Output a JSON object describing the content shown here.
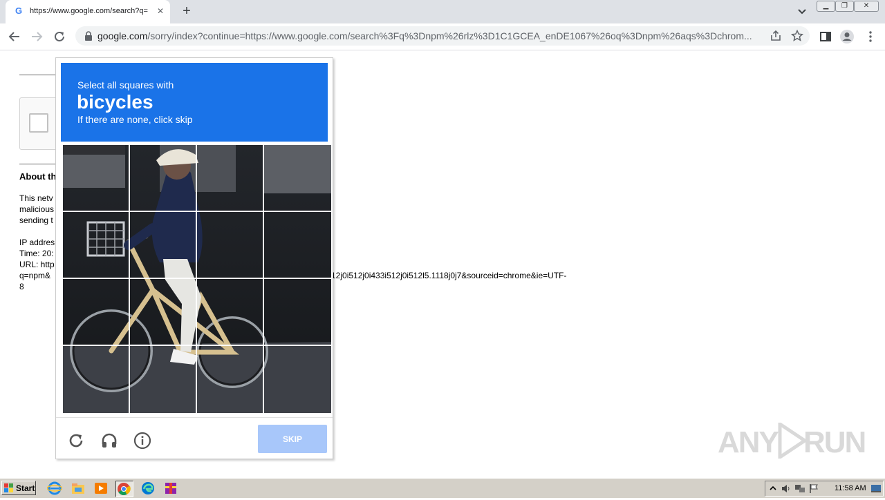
{
  "browser": {
    "tab_title": "https://www.google.com/search?q=",
    "tab_favicon": "G",
    "url_host": "google.com",
    "url_rest": "/sorry/index?continue=https://www.google.com/search%3Fq%3Dnpm%26rlz%3D1C1GCEA_enDE1067%26oq%3Dnpm%26aqs%3Dchrom..."
  },
  "page": {
    "about_heading": "About th",
    "para1": [
      "This netv",
      "malicious",
      "sending t"
    ],
    "para2": [
      "IP addres",
      "Time: 20:",
      "URL: http",
      "q=npm&",
      "8"
    ],
    "url_tail": "12j0i512j0i433i512j0i512l5.1118j0j7&sourceid=chrome&ie=UTF-"
  },
  "captcha": {
    "prompt_line1": "Select all squares with",
    "target": "bicycles",
    "prompt_line3": "If there are none, click skip",
    "skip_label": "SKIP",
    "colors": {
      "header": "#1a73e8",
      "skip": "#a8c7fa"
    }
  },
  "watermark": {
    "left": "ANY",
    "right": "RUN"
  },
  "taskbar": {
    "start_label": "Start",
    "clock": "11:58 AM"
  }
}
